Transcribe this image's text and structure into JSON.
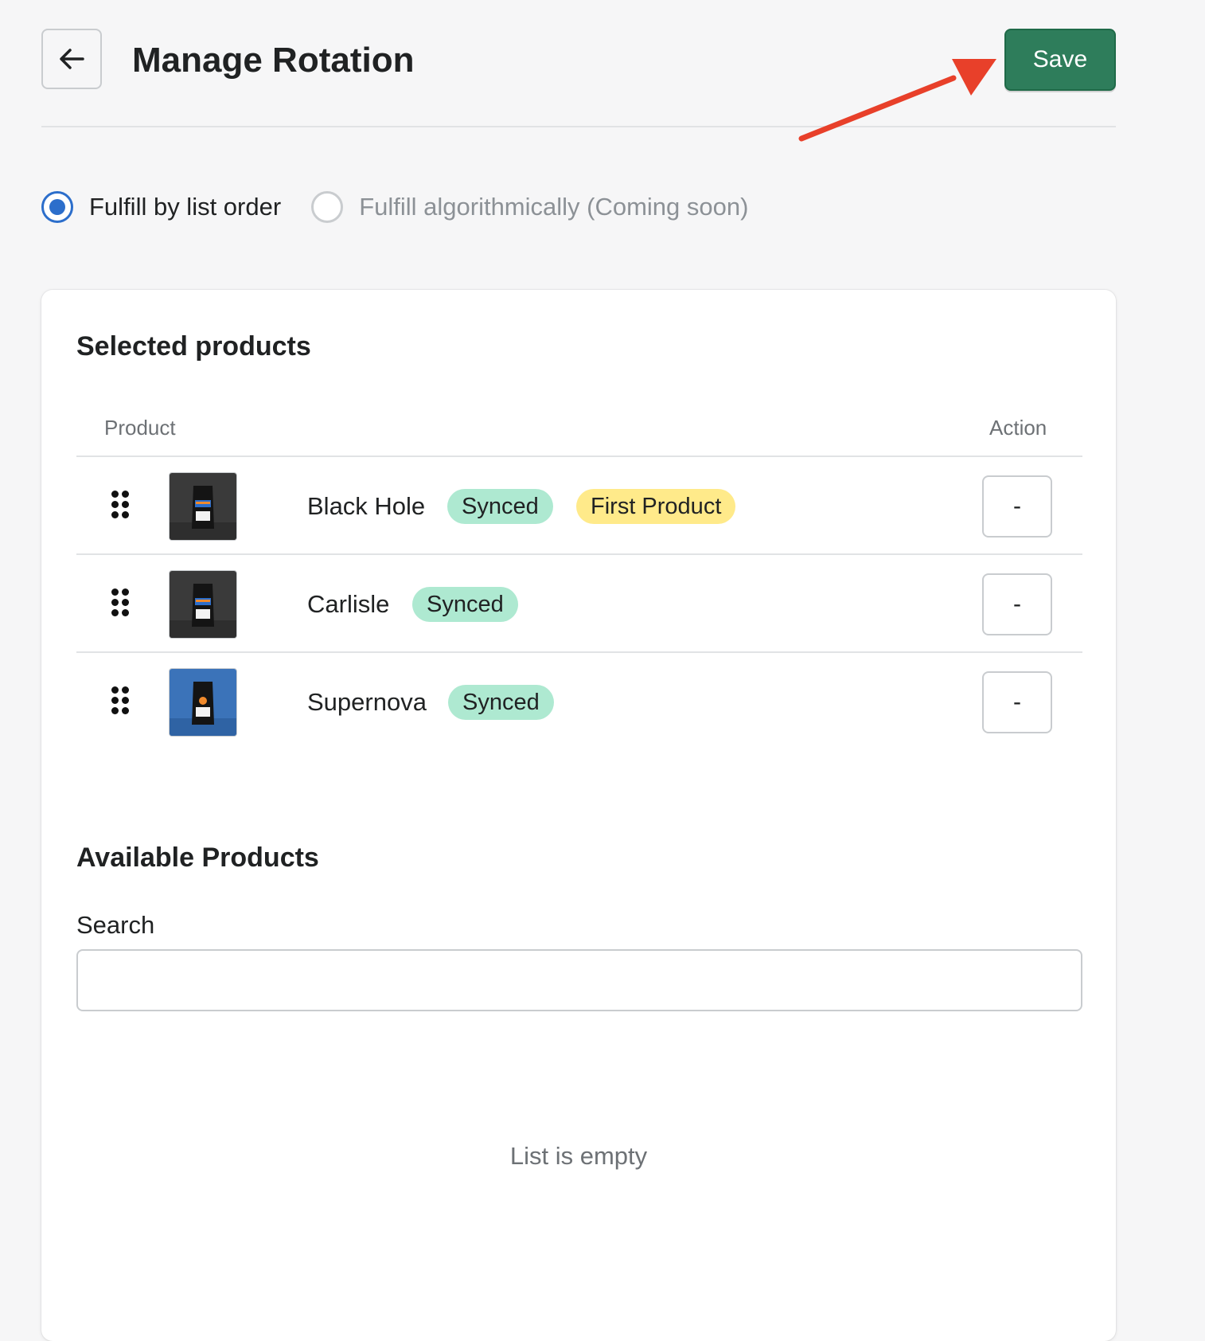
{
  "header": {
    "title": "Manage Rotation",
    "save_label": "Save",
    "back_icon": "arrow-left-icon"
  },
  "fulfillment": {
    "options": [
      {
        "label": "Fulfill by list order",
        "checked": true,
        "disabled": false
      },
      {
        "label": "Fulfill algorithmically (Coming soon)",
        "checked": false,
        "disabled": true
      }
    ]
  },
  "selected_products": {
    "title": "Selected products",
    "columns": {
      "product": "Product",
      "action": "Action"
    },
    "rows": [
      {
        "name": "Black Hole",
        "badges": [
          "Synced",
          "First Product"
        ],
        "action_label": "-",
        "thumb_color": "#3a3a3a"
      },
      {
        "name": "Carlisle",
        "badges": [
          "Synced"
        ],
        "action_label": "-",
        "thumb_color": "#3a3a3a"
      },
      {
        "name": "Supernova",
        "badges": [
          "Synced"
        ],
        "action_label": "-",
        "thumb_color": "#3b73b9"
      }
    ]
  },
  "available_products": {
    "title": "Available Products",
    "search_label": "Search",
    "search_value": "",
    "search_placeholder": "",
    "empty_text": "List is empty"
  },
  "colors": {
    "primary": "#2e7d5b",
    "radio_accent": "#2c6ecb",
    "badge_synced": "#aee9d1",
    "badge_first": "#ffea8a",
    "annotation_arrow": "#e8402a"
  }
}
